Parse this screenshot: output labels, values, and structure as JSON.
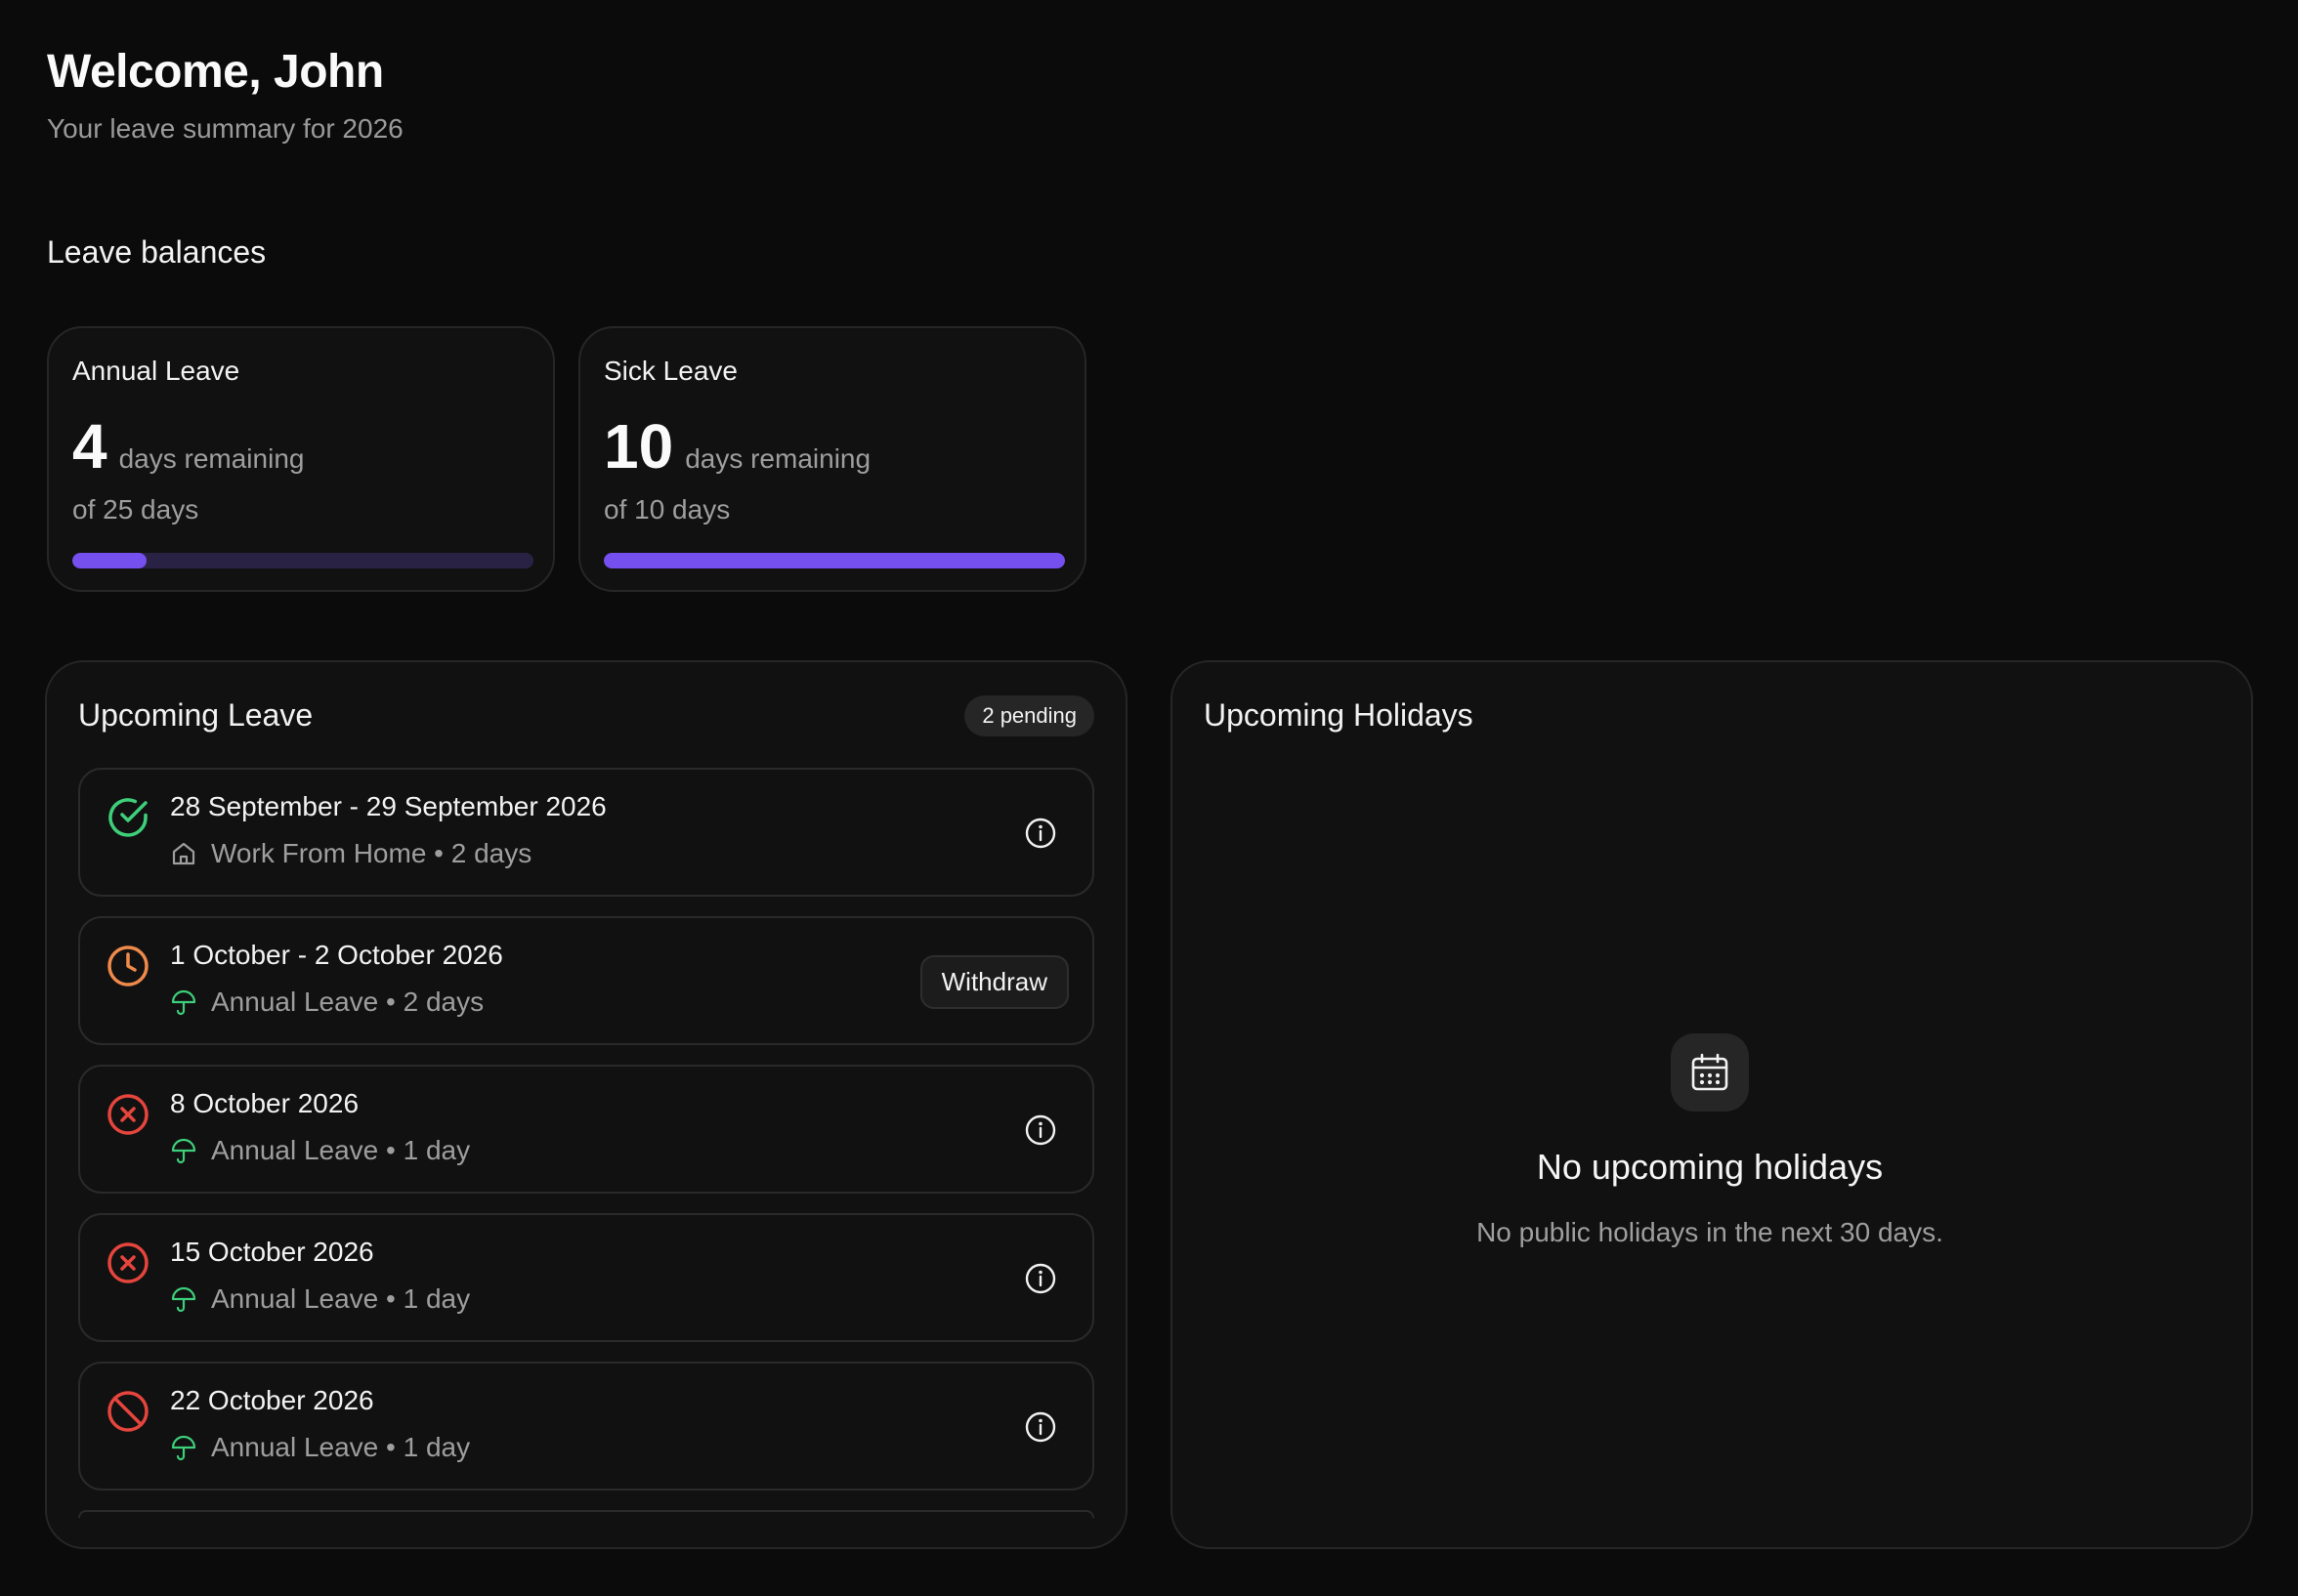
{
  "header": {
    "title": "Welcome, John",
    "subtitle": "Your leave summary for 2026"
  },
  "balances": {
    "title": "Leave balances",
    "cards": [
      {
        "name": "Annual Leave",
        "remaining": "4",
        "remaining_label": "days remaining",
        "total": "of 25 days",
        "fraction": 0.16
      },
      {
        "name": "Sick Leave",
        "remaining": "10",
        "remaining_label": "days remaining",
        "total": "of 10 days",
        "fraction": 1.0
      }
    ]
  },
  "upcoming_leave": {
    "title": "Upcoming Leave",
    "badge": "2 pending",
    "items": [
      {
        "dates": "28 September - 29 September 2026",
        "detail": "Work From Home • 2 days",
        "status": "approved",
        "type_icon": "home-icon"
      },
      {
        "dates": "1 October - 2 October 2026",
        "detail": "Annual Leave • 2 days",
        "status": "pending",
        "type_icon": "umbrella-icon",
        "action": "Withdraw"
      },
      {
        "dates": "8 October 2026",
        "detail": "Annual Leave • 1 day",
        "status": "rejected",
        "type_icon": "umbrella-icon"
      },
      {
        "dates": "15 October 2026",
        "detail": "Annual Leave • 1 day",
        "status": "rejected",
        "type_icon": "umbrella-icon"
      },
      {
        "dates": "22 October 2026",
        "detail": "Annual Leave • 1 day",
        "status": "cancelled",
        "type_icon": "umbrella-icon"
      }
    ]
  },
  "upcoming_holidays": {
    "title": "Upcoming Holidays",
    "empty_icon": "calendar-icon",
    "empty_title": "No upcoming holidays",
    "empty_description": "No public holidays in the next 30 days."
  },
  "colors": {
    "background": "#0b0b0b",
    "card": "#111111",
    "accent": "#7650ee",
    "approved": "#3ecf7a",
    "pending": "#f08a4b",
    "rejected": "#e5453d"
  }
}
